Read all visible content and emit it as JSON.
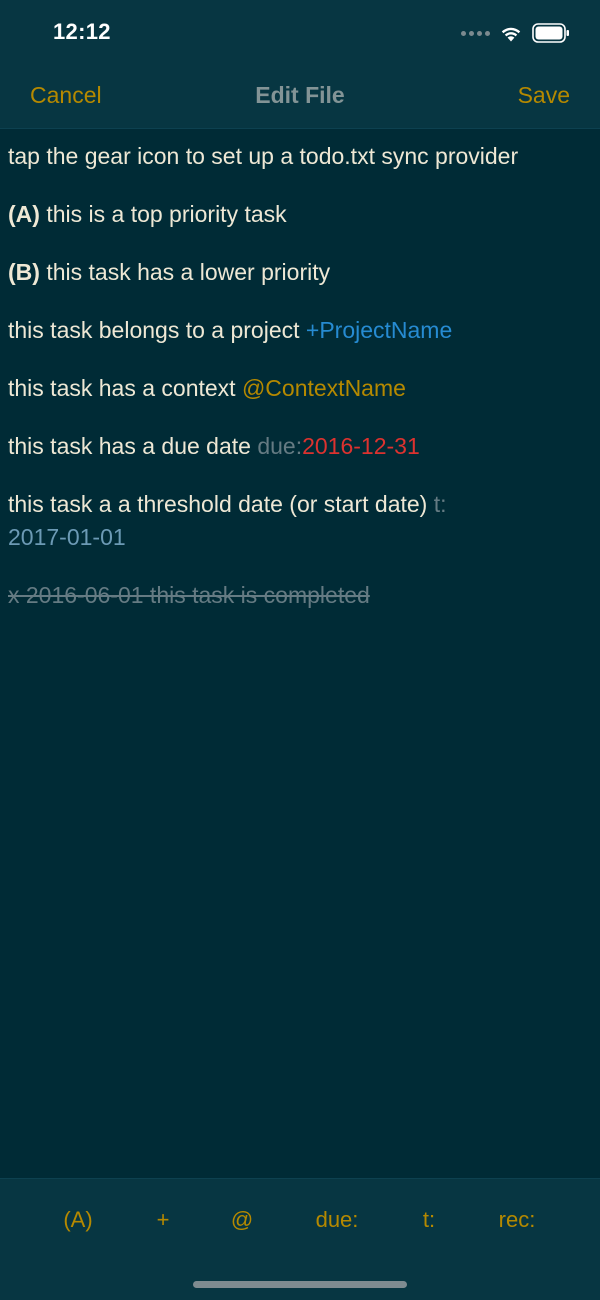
{
  "status_bar": {
    "time": "12:12",
    "icons": [
      "signal-dots-icon",
      "wifi-icon",
      "battery-icon"
    ]
  },
  "nav": {
    "cancel_label": "Cancel",
    "title": "Edit File",
    "save_label": "Save"
  },
  "editor": {
    "lines": [
      {
        "text": "tap the gear icon to set up a todo.txt sync provider"
      },
      {
        "priority": "(A)",
        "text": " this is a top priority task"
      },
      {
        "priority": "(B)",
        "text": " this task has a lower priority"
      },
      {
        "text": "this task belongs to a project ",
        "project": "+ProjectName"
      },
      {
        "text": "this task has a context ",
        "context": "@ContextName"
      },
      {
        "text": "this task has a due date ",
        "due_key": "due:",
        "due_value": "2016-12-31"
      },
      {
        "text": "this task a a threshold date (or start date) ",
        "threshold_key": "t:",
        "threshold_value": "2017-01-01"
      },
      {
        "text": "x 2016-06-01 this task is completed",
        "completed": true
      }
    ]
  },
  "toolbar": {
    "buttons": [
      "(A)",
      "+",
      "@",
      "due:",
      "t:",
      "rec:"
    ]
  },
  "colors": {
    "background": "#002b36",
    "bars": "#073642",
    "accent": "#b58900",
    "text": "#eee8d5",
    "project": "#268bd2",
    "due_date": "#dc322f",
    "muted": "#657b83"
  }
}
